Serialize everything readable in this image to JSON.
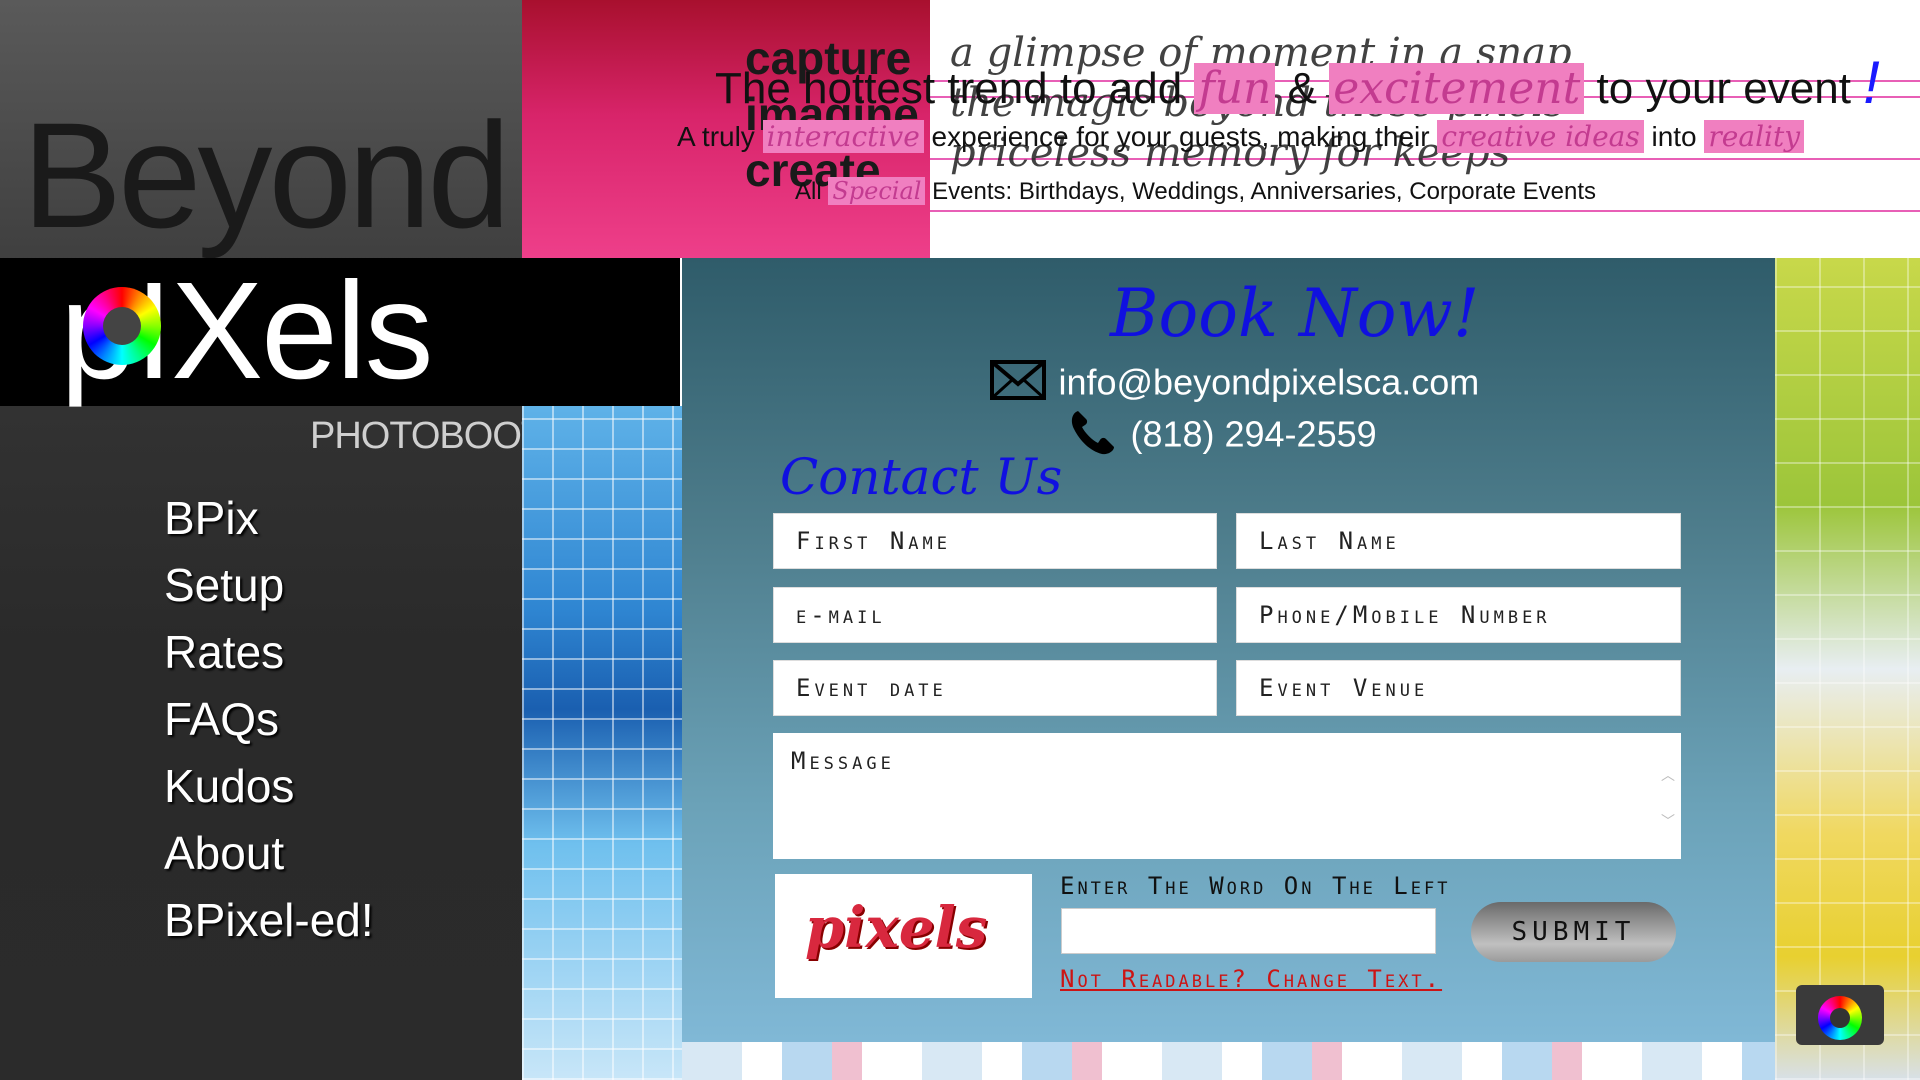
{
  "brand": {
    "logo_top": "Beyond",
    "logo_main": "pIXels",
    "logo_sub": "PHOTOBOOTH"
  },
  "nav": {
    "items": [
      "BPix",
      "Setup",
      "Rates",
      "FAQs",
      "Kudos",
      "About",
      "BPixel-ed!"
    ]
  },
  "banner": {
    "bg_words": [
      "capture",
      "imagine",
      "create"
    ],
    "bg_script": [
      "a glimpse of moment in a snap",
      "the magic beyond those pixels",
      "priceless memory for keeps"
    ],
    "line1_pre": "The hottest trend to add",
    "line1_hl1": "fun",
    "line1_amp": "&",
    "line1_hl2": "excitement",
    "line1_post": "to your event",
    "line1_bang": "!",
    "line2_pre": "A truly",
    "line2_hl1": "interactive",
    "line2_mid": "experience for your guests, making their",
    "line2_hl2": "creative ideas",
    "line2_into": "into",
    "line2_hl3": "reality",
    "line3_pre": "All",
    "line3_hl": "Special",
    "line3_post": "Events: Birthdays, Weddings, Anniversaries, Corporate Events"
  },
  "contact": {
    "heading": "Book Now!",
    "email": "info@beyondpixelsca.com",
    "phone": "(818) 294-2559",
    "form_title": "Contact Us"
  },
  "form": {
    "first_name": "First Name",
    "last_name": "Last Name",
    "email": "e-mail",
    "phone": "Phone/Mobile Number",
    "event_date": "Event date",
    "event_venue": "Event Venue",
    "message": "Message",
    "captcha_word": "pixels",
    "captcha_label": "Enter The Word On The Left",
    "captcha_value": "",
    "change_text": "Not Readable? Change Text.",
    "submit": "SUBMIT"
  },
  "colors": {
    "accent_blue": "#1010e0",
    "highlight_pink": "#f07fc0",
    "link_red": "#cc1414"
  },
  "icons": [
    "envelope-icon",
    "phone-icon",
    "camera-icon",
    "color-wheel-logo"
  ]
}
